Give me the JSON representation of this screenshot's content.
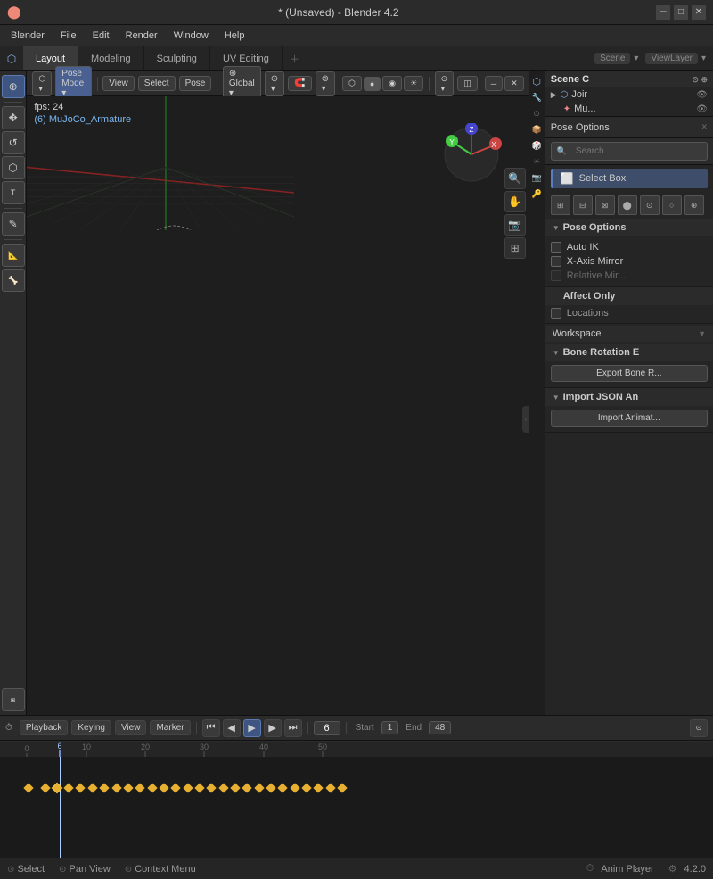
{
  "titleBar": {
    "title": "* (Unsaved) - Blender 4.2",
    "minimize": "─",
    "maximize": "□",
    "close": "✕"
  },
  "menuBar": {
    "items": [
      "Blender",
      "File",
      "Edit",
      "Render",
      "Window",
      "Help"
    ]
  },
  "workspaceTabs": {
    "tabs": [
      "Layout",
      "Modeling",
      "Sculpting",
      "UV Editing"
    ],
    "activeTab": "Layout"
  },
  "viewportHeader": {
    "mode": "Pose Mode",
    "view": "View",
    "select": "Select",
    "pose": "Pose",
    "global": "Global",
    "viewport_shading_icon": "●"
  },
  "viewport": {
    "fps": "fps: 24",
    "objectName": "(6) MuJoCo_Armature"
  },
  "rightPanel": {
    "title": "Pose Options",
    "search_placeholder": "Search",
    "selectBox": "Select Box",
    "poseOptions": {
      "label": "Pose Options",
      "autoIK": "Auto IK",
      "xAxisMirror": "X-Axis Mirror",
      "relativeMirror": "Relative Mir...",
      "autoIKChecked": false,
      "xAxisMirrorChecked": false,
      "relativeMirrorChecked": false
    },
    "affectOnly": {
      "label": "Affect Only",
      "locations": "Locations"
    },
    "workspace": {
      "label": "Workspace"
    },
    "boneRotation": {
      "label": "Bone Rotation E",
      "exportBtn": "Export Bone R...",
      "importJsonLabel": "Import JSON An",
      "importAnimBtn": "Import Animat..."
    }
  },
  "timeline": {
    "playback": "Playback",
    "keying": "Keying",
    "view": "View",
    "marker": "Marker",
    "currentFrame": "6",
    "startFrame": "1",
    "endFrame": "48",
    "startLabel": "Start",
    "endLabel": "End",
    "frameNumbers": [
      "0",
      "6",
      "10",
      "20",
      "30",
      "40",
      "50"
    ]
  },
  "statusBar": {
    "select": "Select",
    "panView": "Pan View",
    "contextMenu": "Context Menu",
    "animPlayer": "Anim Player",
    "version": "4.2.0"
  },
  "leftTools": {
    "tools": [
      "⊕",
      "✥",
      "↺",
      "⬡",
      "⬡",
      "✎",
      "✦"
    ]
  },
  "scene": {
    "title": "Scene C",
    "join": "Joir",
    "mujoco": "Mu..."
  }
}
